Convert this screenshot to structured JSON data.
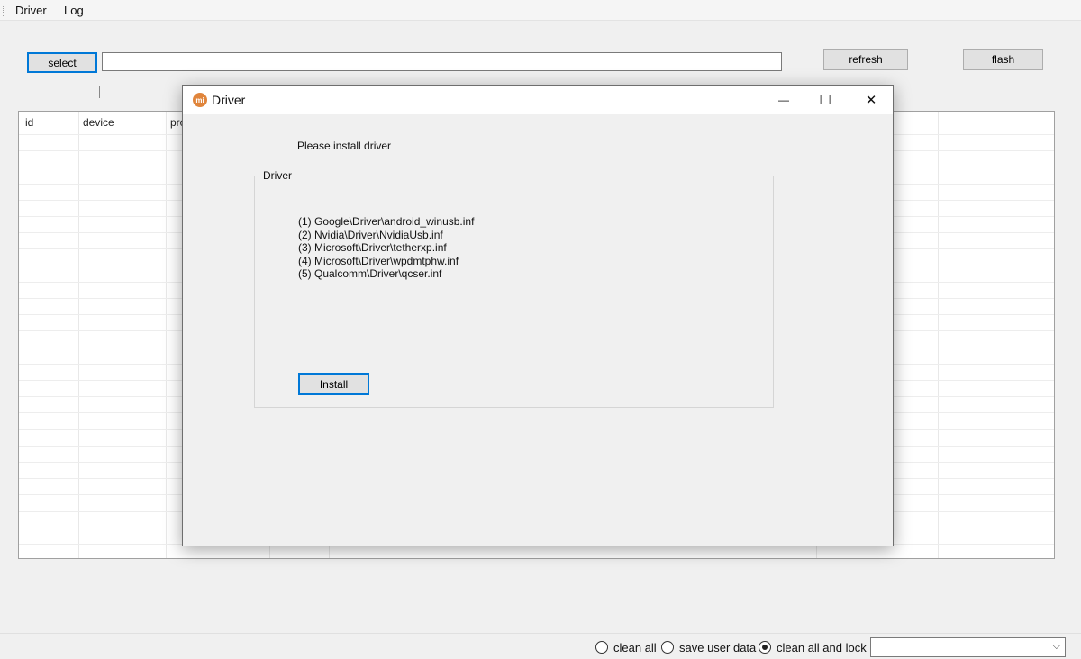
{
  "menubar": {
    "items": [
      "Driver",
      "Log"
    ]
  },
  "toolbar": {
    "select_label": "select",
    "path_value": "",
    "refresh_label": "refresh",
    "flash_label": "flash"
  },
  "grid": {
    "columns": [
      "id",
      "device",
      "pro"
    ]
  },
  "dialog": {
    "title": "Driver",
    "logo_text": "mi",
    "message": "Please install driver",
    "group_title": "Driver",
    "drivers": [
      "(1) Google\\Driver\\android_winusb.inf",
      "(2) Nvidia\\Driver\\NvidiaUsb.inf",
      "(3) Microsoft\\Driver\\tetherxp.inf",
      "(4) Microsoft\\Driver\\wpdmtphw.inf",
      "(5) Qualcomm\\Driver\\qcser.inf"
    ],
    "install_label": "Install",
    "minimize_glyph": "—",
    "maximize_glyph": "☐",
    "close_glyph": "✕"
  },
  "statusbar": {
    "options": [
      {
        "label": "clean all",
        "checked": false
      },
      {
        "label": "save user data",
        "checked": false
      },
      {
        "label": "clean all and lock",
        "checked": true
      }
    ],
    "combo_value": "",
    "combo_arrow": "⌵"
  }
}
